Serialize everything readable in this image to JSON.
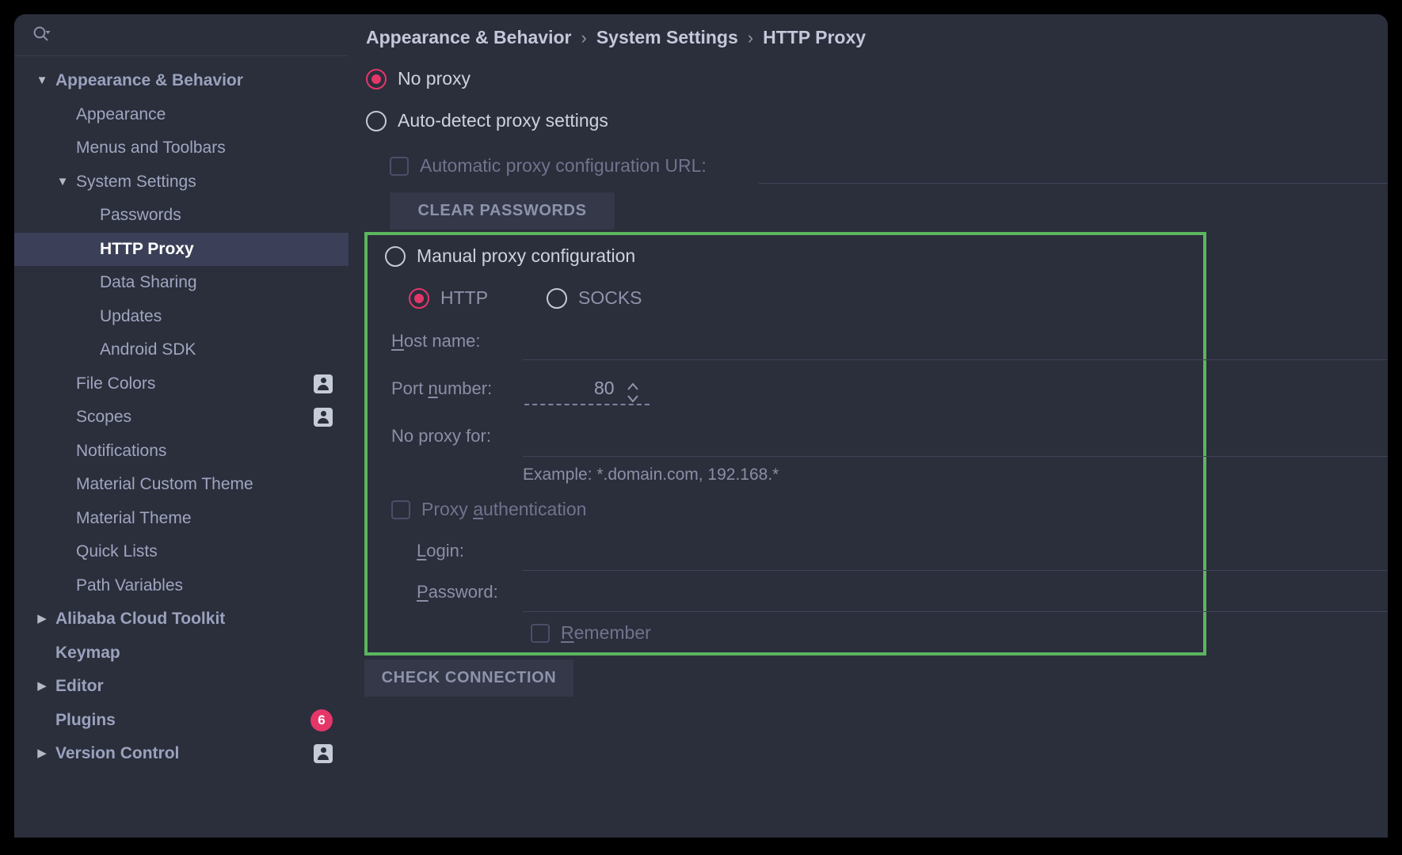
{
  "window": {
    "title": "Settings"
  },
  "theme": {
    "bg": "#2b2e3b",
    "selection": "#3b3f57",
    "accent_radio": "#e5366a",
    "badge": "#e5366a",
    "highlight_border": "#5cb55f",
    "text": "#ced2e0",
    "muted": "#8a8fa6"
  },
  "search": {
    "placeholder": "",
    "value": "",
    "icon": "search-icon"
  },
  "sidebar": {
    "items": [
      {
        "label": "Appearance & Behavior",
        "level": 0,
        "arrow": "▼",
        "bold": true,
        "selected": false,
        "badge": null,
        "user_icon": false
      },
      {
        "label": "Appearance",
        "level": 1,
        "arrow": "",
        "bold": false,
        "selected": false,
        "badge": null,
        "user_icon": false
      },
      {
        "label": "Menus and Toolbars",
        "level": 1,
        "arrow": "",
        "bold": false,
        "selected": false,
        "badge": null,
        "user_icon": false
      },
      {
        "label": "System Settings",
        "level": 1,
        "arrow": "▼",
        "bold": false,
        "selected": false,
        "badge": null,
        "user_icon": false
      },
      {
        "label": "Passwords",
        "level": 2,
        "arrow": "",
        "bold": false,
        "selected": false,
        "badge": null,
        "user_icon": false
      },
      {
        "label": "HTTP Proxy",
        "level": 2,
        "arrow": "",
        "bold": false,
        "selected": true,
        "badge": null,
        "user_icon": false
      },
      {
        "label": "Data Sharing",
        "level": 2,
        "arrow": "",
        "bold": false,
        "selected": false,
        "badge": null,
        "user_icon": false
      },
      {
        "label": "Updates",
        "level": 2,
        "arrow": "",
        "bold": false,
        "selected": false,
        "badge": null,
        "user_icon": false
      },
      {
        "label": "Android SDK",
        "level": 2,
        "arrow": "",
        "bold": false,
        "selected": false,
        "badge": null,
        "user_icon": false
      },
      {
        "label": "File Colors",
        "level": 1,
        "arrow": "",
        "bold": false,
        "selected": false,
        "badge": null,
        "user_icon": true
      },
      {
        "label": "Scopes",
        "level": 1,
        "arrow": "",
        "bold": false,
        "selected": false,
        "badge": null,
        "user_icon": true
      },
      {
        "label": "Notifications",
        "level": 1,
        "arrow": "",
        "bold": false,
        "selected": false,
        "badge": null,
        "user_icon": false
      },
      {
        "label": "Material Custom Theme",
        "level": 1,
        "arrow": "",
        "bold": false,
        "selected": false,
        "badge": null,
        "user_icon": false
      },
      {
        "label": "Material Theme",
        "level": 1,
        "arrow": "",
        "bold": false,
        "selected": false,
        "badge": null,
        "user_icon": false
      },
      {
        "label": "Quick Lists",
        "level": 1,
        "arrow": "",
        "bold": false,
        "selected": false,
        "badge": null,
        "user_icon": false
      },
      {
        "label": "Path Variables",
        "level": 1,
        "arrow": "",
        "bold": false,
        "selected": false,
        "badge": null,
        "user_icon": false
      },
      {
        "label": "Alibaba Cloud Toolkit",
        "level": 0,
        "arrow": "▶",
        "bold": true,
        "selected": false,
        "badge": null,
        "user_icon": false
      },
      {
        "label": "Keymap",
        "level": 0,
        "arrow": "",
        "bold": true,
        "selected": false,
        "badge": null,
        "user_icon": false
      },
      {
        "label": "Editor",
        "level": 0,
        "arrow": "▶",
        "bold": true,
        "selected": false,
        "badge": null,
        "user_icon": false
      },
      {
        "label": "Plugins",
        "level": 0,
        "arrow": "",
        "bold": true,
        "selected": false,
        "badge": "6",
        "user_icon": false
      },
      {
        "label": "Version Control",
        "level": 0,
        "arrow": "▶",
        "bold": true,
        "selected": false,
        "badge": null,
        "user_icon": true
      }
    ]
  },
  "breadcrumb": {
    "parts": [
      "Appearance & Behavior",
      "System Settings",
      "HTTP Proxy"
    ],
    "separator": "›"
  },
  "main": {
    "proxy_mode_selected": "no_proxy",
    "options": {
      "no_proxy": "No proxy",
      "auto_detect": "Auto-detect proxy settings",
      "manual": "Manual proxy configuration"
    },
    "auto_pac": {
      "label": "Automatic proxy configuration URL:",
      "checked": false,
      "value": ""
    },
    "clear_passwords_label": "CLEAR PASSWORDS",
    "manual": {
      "protocol_selected": "HTTP",
      "protocols": [
        "HTTP",
        "SOCKS"
      ],
      "host_name": {
        "label": "Host name:",
        "mnemonic": "H",
        "value": ""
      },
      "port_number": {
        "label": "Port number:",
        "mnemonic": "n",
        "value": "80"
      },
      "no_proxy_for": {
        "label": "No proxy for:",
        "value": ""
      },
      "example_hint": "Example: *.domain.com, 192.168.*",
      "proxy_authentication": {
        "label": "Proxy authentication",
        "mnemonic": "a",
        "checked": false
      },
      "login": {
        "label": "Login:",
        "mnemonic": "L",
        "value": ""
      },
      "password": {
        "label": "Password:",
        "mnemonic": "P",
        "value": ""
      },
      "remember": {
        "label": "Remember",
        "mnemonic": "R",
        "checked": false
      }
    },
    "check_connection_label": "CHECK CONNECTION"
  }
}
